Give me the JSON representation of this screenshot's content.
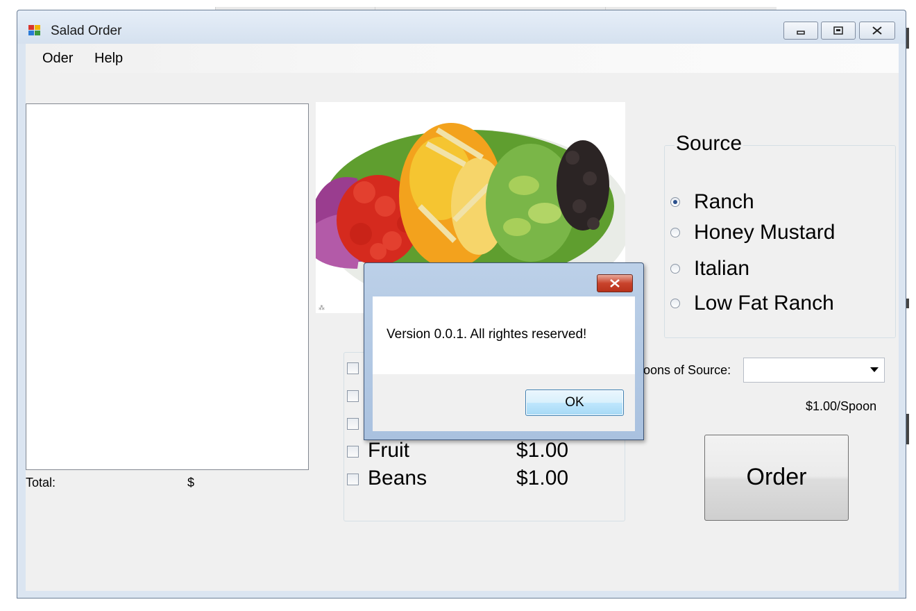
{
  "window": {
    "title": "Salad Order",
    "controls": [
      "minimize-icon",
      "restore-icon",
      "close-icon"
    ]
  },
  "menu": {
    "items": [
      {
        "label": "Oder"
      },
      {
        "label": "Help"
      }
    ]
  },
  "order_list": {
    "items": [],
    "total_label": "Total:",
    "total_value": "$"
  },
  "source_group": {
    "title": "Source",
    "options": [
      {
        "label": "Ranch",
        "selected": true
      },
      {
        "label": "Honey Mustard",
        "selected": false
      },
      {
        "label": "Italian",
        "selected": false
      },
      {
        "label": "Low Fat Ranch",
        "selected": false
      }
    ]
  },
  "toppings": {
    "items": [
      {
        "name": "",
        "price": ""
      },
      {
        "name": "",
        "price": ""
      },
      {
        "name": "",
        "price": ""
      },
      {
        "name": "Fruit",
        "price": "$1.00"
      },
      {
        "name": "Beans",
        "price": "$1.00"
      }
    ]
  },
  "spoons": {
    "label": "poons of Source:",
    "value": "",
    "price_note": "$1.00/Spoon"
  },
  "order_button": {
    "label": "Order"
  },
  "dialog": {
    "message": "Version 0.0.1. All rightes reserved!",
    "ok_label": "OK"
  },
  "colors": {
    "window_frame": "#dbe5f1",
    "client_bg": "#f0f0f0",
    "dialog_close": "#c9432c",
    "ok_button_border": "#3c7fb1"
  }
}
